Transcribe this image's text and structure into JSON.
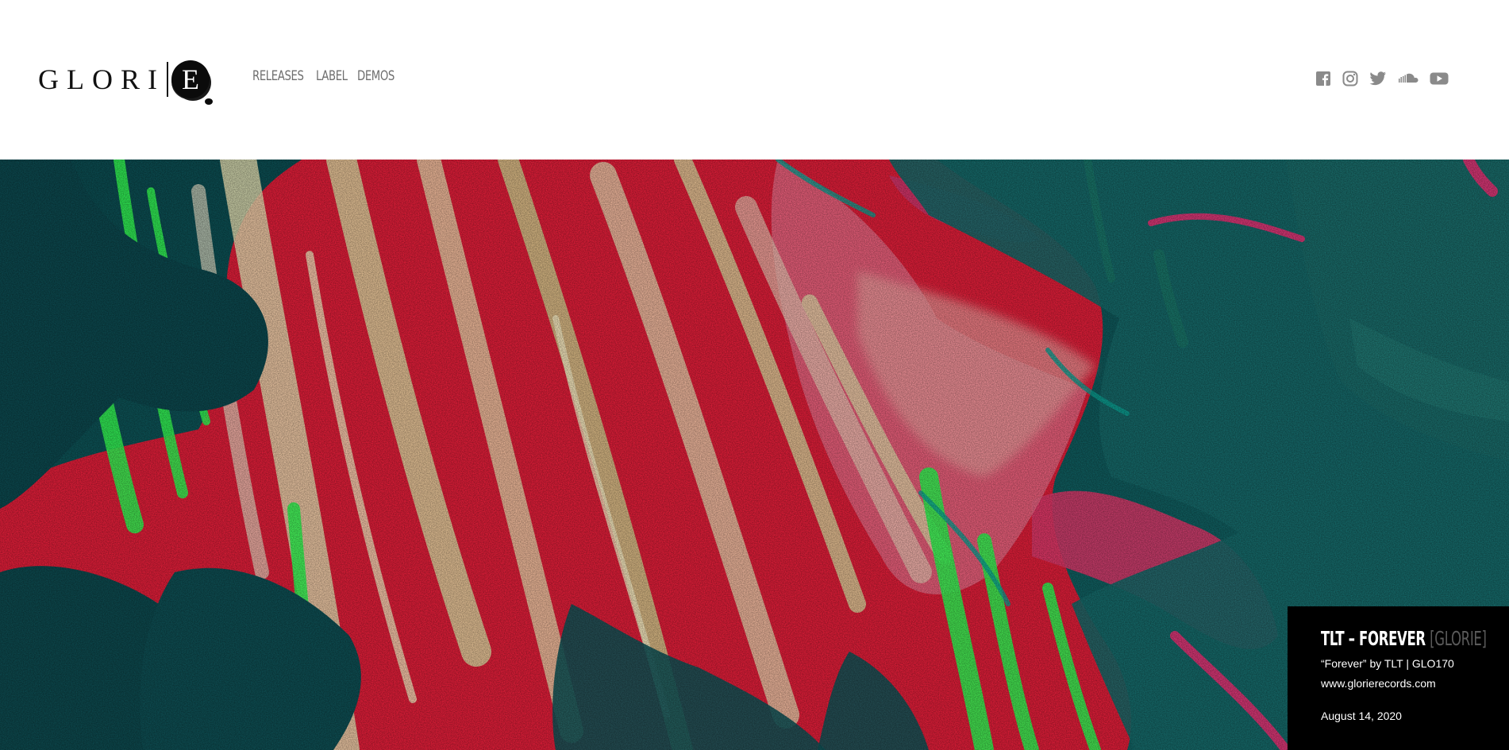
{
  "brand": {
    "logo_text": "GLORI",
    "logo_seal_letter": "E"
  },
  "nav": {
    "items": [
      {
        "label": "RELEASES"
      },
      {
        "label": "LABEL"
      },
      {
        "label": "DEMOS"
      }
    ]
  },
  "social": {
    "icons": [
      "facebook-icon",
      "instagram-icon",
      "twitter-icon",
      "soundcloud-icon",
      "youtube-icon"
    ],
    "icon_color": "#8a8a8a"
  },
  "hero": {
    "colors": {
      "base": "#0f5a5a",
      "red": "#e8203a",
      "pink": "#f0608a",
      "cream": "#e8d9b0",
      "green": "#39ff5a",
      "teal": "#167070"
    }
  },
  "caption": {
    "title": "TLT – FOREVER",
    "brand_tag": "[GLORIE]",
    "subtitle": "“Forever” by TLT | GLO170",
    "website": "www.glorierecords.com",
    "date": "August 14, 2020"
  }
}
